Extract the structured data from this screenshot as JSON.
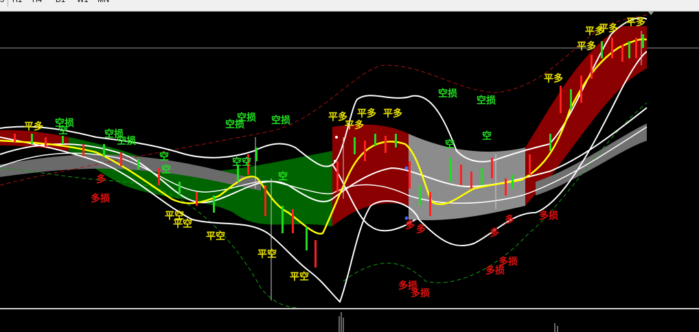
{
  "toolbar": {
    "timeframes": [
      {
        "label": "5"
      },
      {
        "label": "H1"
      },
      {
        "label": "H4"
      },
      {
        "label": "D1"
      },
      {
        "label": "W1"
      },
      {
        "label": "MN"
      }
    ]
  },
  "colors": {
    "background": "#000000",
    "bull_band": "#8b0000",
    "bear_band": "#006400",
    "neutral_band": "#8c8c8c",
    "signal_yellow": "#e8e000",
    "signal_green": "#22dd22",
    "signal_red": "#e01010",
    "ma_line": "#ffff00",
    "envelope": "#ffffff"
  },
  "signals": [
    {
      "text": "平多",
      "color": "#e8e000"
    },
    {
      "text": "空损",
      "color": "#22dd22"
    },
    {
      "text": "空",
      "color": "#22dd22"
    },
    {
      "text": "空损",
      "color": "#22dd22"
    },
    {
      "text": "空损",
      "color": "#22dd22"
    },
    {
      "text": "空",
      "color": "#22dd22"
    },
    {
      "text": "空",
      "color": "#22dd22"
    },
    {
      "text": "多",
      "color": "#e01010"
    },
    {
      "text": "多损",
      "color": "#e01010"
    },
    {
      "text": "平空",
      "color": "#e8e000"
    },
    {
      "text": "平空",
      "color": "#e8e000"
    },
    {
      "text": "平空",
      "color": "#e8e000"
    },
    {
      "text": "空损",
      "color": "#22dd22"
    },
    {
      "text": "空损",
      "color": "#22dd22"
    },
    {
      "text": "空损",
      "color": "#22dd22"
    },
    {
      "text": "空空",
      "color": "#22dd22"
    },
    {
      "text": "空",
      "color": "#22dd22"
    },
    {
      "text": "平空",
      "color": "#e8e000"
    },
    {
      "text": "平空",
      "color": "#e8e000"
    },
    {
      "text": "平多",
      "color": "#e8e000"
    },
    {
      "text": "平多",
      "color": "#e8e000"
    },
    {
      "text": "平多",
      "color": "#e8e000"
    },
    {
      "text": "平多",
      "color": "#e8e000"
    },
    {
      "text": "空损",
      "color": "#22dd22"
    },
    {
      "text": "空损",
      "color": "#22dd22"
    },
    {
      "text": "空",
      "color": "#22dd22"
    },
    {
      "text": "空",
      "color": "#22dd22"
    },
    {
      "text": "多",
      "color": "#e01010"
    },
    {
      "text": "多",
      "color": "#e01010"
    },
    {
      "text": "多",
      "color": "#e01010"
    },
    {
      "text": "多",
      "color": "#e01010"
    },
    {
      "text": "多损",
      "color": "#e01010"
    },
    {
      "text": "多损",
      "color": "#e01010"
    },
    {
      "text": "多损",
      "color": "#e01010"
    },
    {
      "text": "多损",
      "color": "#e01010"
    },
    {
      "text": "多损",
      "color": "#e01010"
    },
    {
      "text": "平多",
      "color": "#e8e000"
    },
    {
      "text": "平多",
      "color": "#e8e000"
    },
    {
      "text": "平多",
      "color": "#e8e000"
    },
    {
      "text": "平多",
      "color": "#e8e000"
    },
    {
      "text": "平多",
      "color": "#e8e000"
    }
  ]
}
